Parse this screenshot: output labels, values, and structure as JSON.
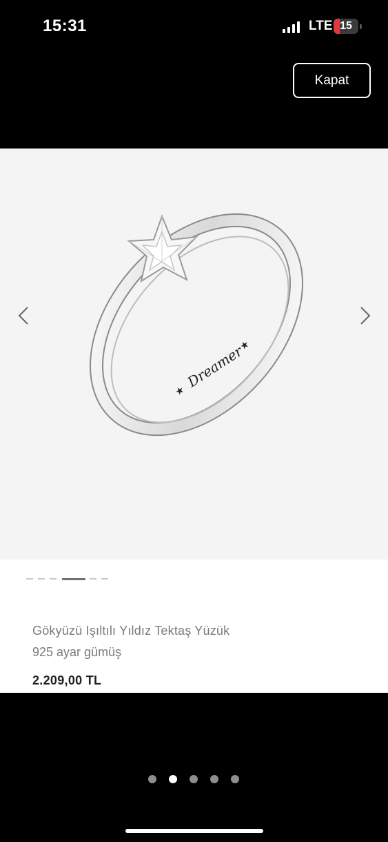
{
  "status_bar": {
    "time": "15:31",
    "network": "LTE",
    "battery": "15"
  },
  "header": {
    "close_label": "Kapat"
  },
  "product": {
    "engraving": "Dreamer",
    "title": "Gökyüzü Işıltılı Yıldız Tektaş Yüzük",
    "material": "925 ayar gümüş",
    "price": "2.209,00 TL"
  },
  "carousel": {
    "image_count": 6,
    "active_image": 4
  },
  "pager": {
    "count": 5,
    "active": 2
  },
  "colors": {
    "background": "#000000",
    "image_bg": "#f4f4f4",
    "battery_low": "#e0383e"
  }
}
